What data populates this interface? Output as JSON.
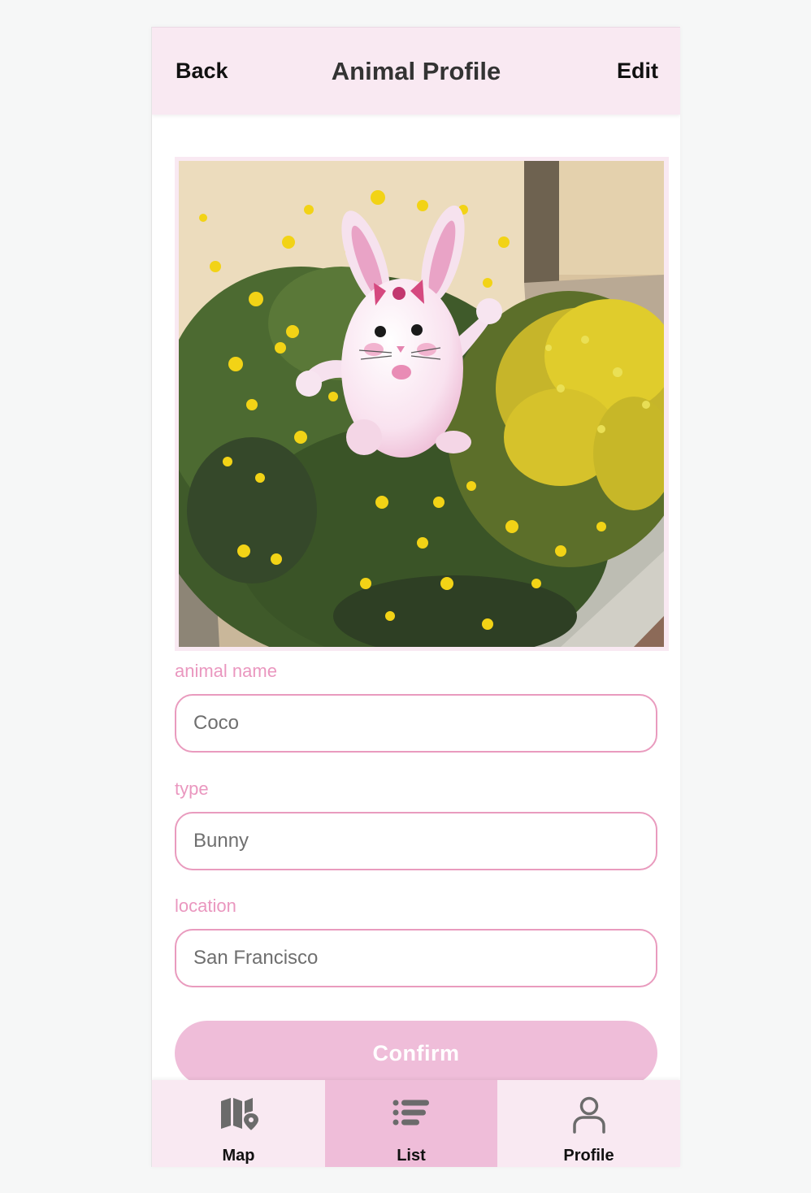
{
  "header": {
    "back_label": "Back",
    "title": "Animal Profile",
    "edit_label": "Edit"
  },
  "photo": {
    "subject": "cartoon pink bunny with red bow over a yellow flower bush"
  },
  "form": {
    "name_label": "animal name",
    "name_value": "Coco",
    "type_label": "type",
    "type_value": "Bunny",
    "location_label": "location",
    "location_value": "San Francisco",
    "confirm_label": "Confirm"
  },
  "tabbar": {
    "tabs": [
      {
        "label": "Map",
        "icon": "map-icon"
      },
      {
        "label": "List",
        "icon": "list-icon",
        "active": true
      },
      {
        "label": "Profile",
        "icon": "person-icon"
      }
    ]
  },
  "colors": {
    "header_bg": "#f9e9f2",
    "accent_pink": "#efbdd9",
    "label_pink": "#ea97bf",
    "border_pink": "#e99bbe"
  }
}
